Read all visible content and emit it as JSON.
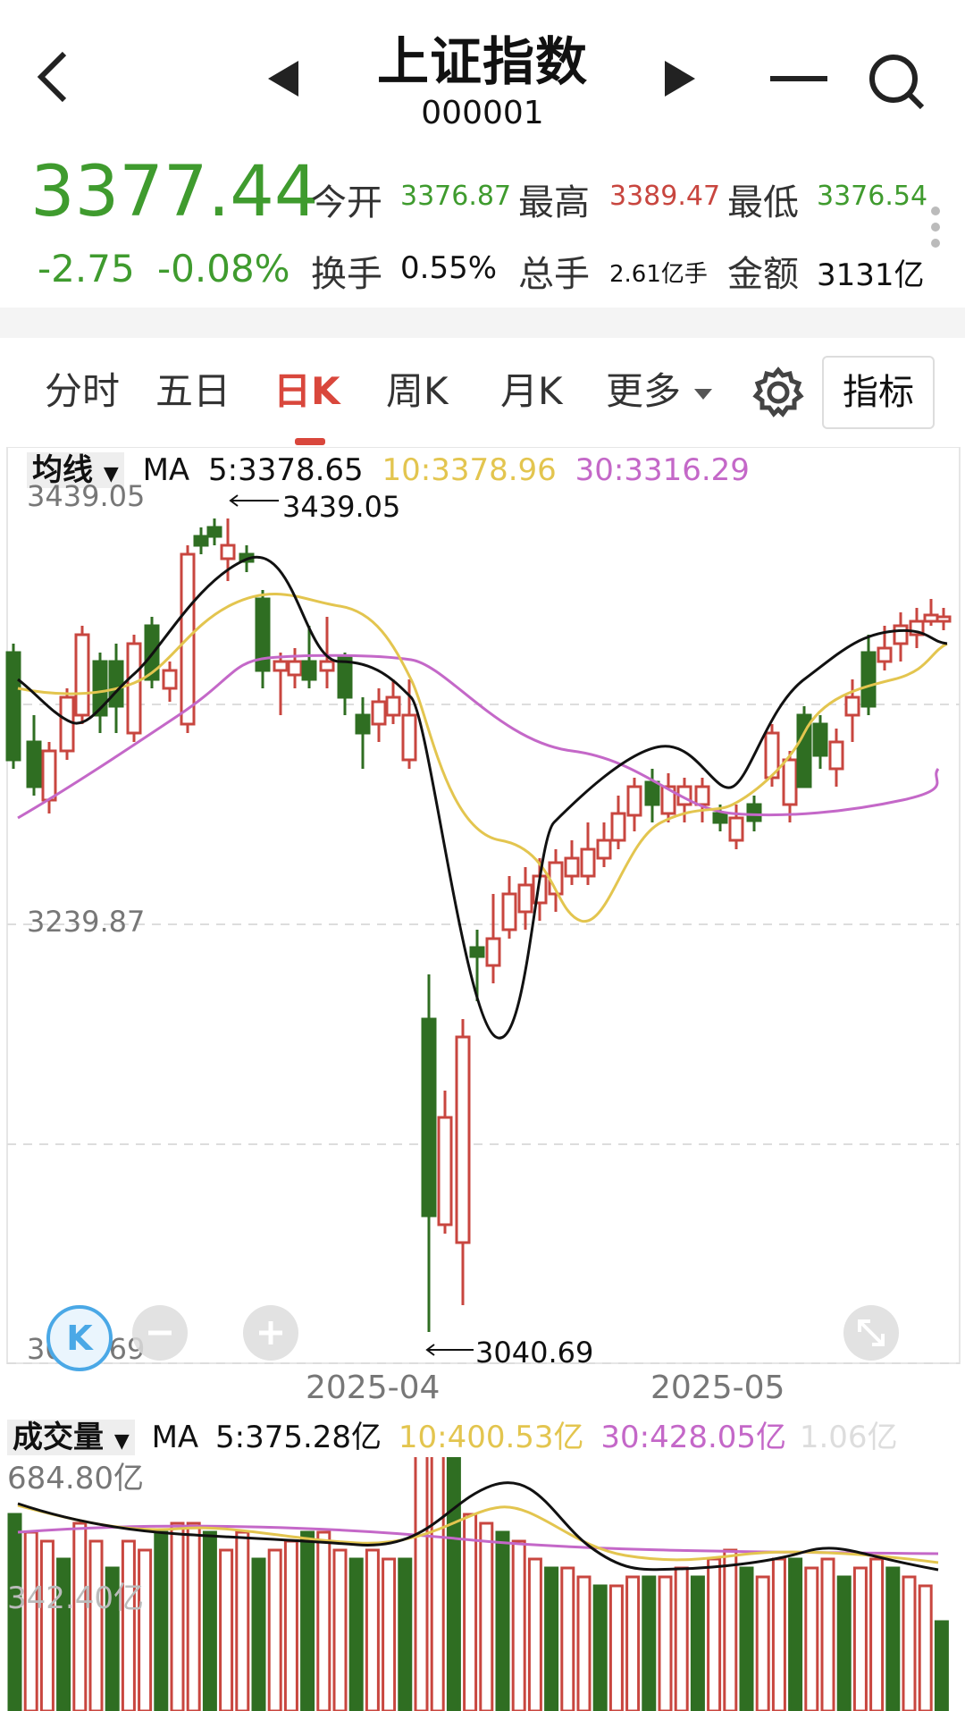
{
  "header": {
    "title": "上证指数",
    "code": "000001",
    "back_icon": "back-arrow-icon",
    "prev_icon": "prev-triangle-icon",
    "next_icon": "next-triangle-icon",
    "menu_icon": "minus-icon",
    "search_icon": "search-icon"
  },
  "quote": {
    "price": "3377.44",
    "change": "-2.75",
    "change_pct": "-0.08%",
    "open_label": "今开",
    "open": "3376.87",
    "high_label": "最高",
    "high": "3389.47",
    "low_label": "最低",
    "low": "3376.54",
    "turnover_label": "换手",
    "turnover": "0.55%",
    "volume_label": "总手",
    "volume": "2.61亿手",
    "amount_label": "金额",
    "amount": "3131亿"
  },
  "tabs": [
    {
      "label": "分时"
    },
    {
      "label": "五日"
    },
    {
      "label": "日K"
    },
    {
      "label": "周K"
    },
    {
      "label": "月K"
    },
    {
      "label": "更多"
    }
  ],
  "indicator_button": "指标",
  "kline": {
    "selector": "均线",
    "ma_label": "MA",
    "ma5": "5:3378.65",
    "ma10": "10:3378.96",
    "ma30": "30:3316.29",
    "y_top": "3439.05",
    "y_mid": "3239.87",
    "y_bottom": "3040.69",
    "high_mark": "3439.05",
    "low_mark": "3040.69",
    "x_labels": [
      "2025-04",
      "2025-05"
    ]
  },
  "volume": {
    "selector": "成交量",
    "ma_label": "MA",
    "ma5": "5:375.28亿",
    "ma10": "10:400.53亿",
    "ma30": "30:428.05亿",
    "faded": "1.06亿",
    "y_top": "684.80亿",
    "y_mid": "342.40亿"
  },
  "colors": {
    "up": "#c8463f",
    "down": "#2f6e22",
    "ma5": "#111111",
    "ma10": "#e3c54f",
    "ma30": "#c468c8",
    "accent": "#d9473c"
  }
}
